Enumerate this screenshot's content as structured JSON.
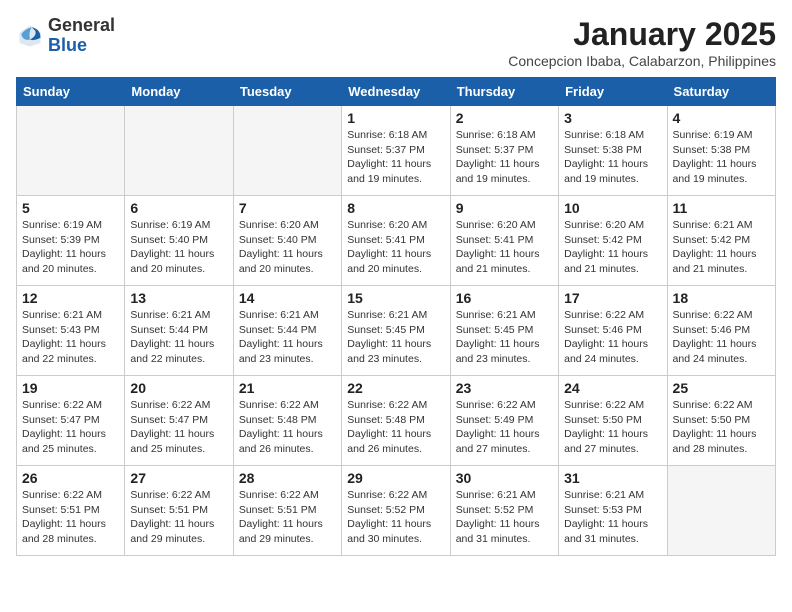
{
  "header": {
    "logo": {
      "general": "General",
      "blue": "Blue"
    },
    "title": "January 2025",
    "subtitle": "Concepcion Ibaba, Calabarzon, Philippines"
  },
  "calendar": {
    "days_of_week": [
      "Sunday",
      "Monday",
      "Tuesday",
      "Wednesday",
      "Thursday",
      "Friday",
      "Saturday"
    ],
    "weeks": [
      [
        {
          "day": "",
          "info": ""
        },
        {
          "day": "",
          "info": ""
        },
        {
          "day": "",
          "info": ""
        },
        {
          "day": "1",
          "info": "Sunrise: 6:18 AM\nSunset: 5:37 PM\nDaylight: 11 hours and 19 minutes."
        },
        {
          "day": "2",
          "info": "Sunrise: 6:18 AM\nSunset: 5:37 PM\nDaylight: 11 hours and 19 minutes."
        },
        {
          "day": "3",
          "info": "Sunrise: 6:18 AM\nSunset: 5:38 PM\nDaylight: 11 hours and 19 minutes."
        },
        {
          "day": "4",
          "info": "Sunrise: 6:19 AM\nSunset: 5:38 PM\nDaylight: 11 hours and 19 minutes."
        }
      ],
      [
        {
          "day": "5",
          "info": "Sunrise: 6:19 AM\nSunset: 5:39 PM\nDaylight: 11 hours and 20 minutes."
        },
        {
          "day": "6",
          "info": "Sunrise: 6:19 AM\nSunset: 5:40 PM\nDaylight: 11 hours and 20 minutes."
        },
        {
          "day": "7",
          "info": "Sunrise: 6:20 AM\nSunset: 5:40 PM\nDaylight: 11 hours and 20 minutes."
        },
        {
          "day": "8",
          "info": "Sunrise: 6:20 AM\nSunset: 5:41 PM\nDaylight: 11 hours and 20 minutes."
        },
        {
          "day": "9",
          "info": "Sunrise: 6:20 AM\nSunset: 5:41 PM\nDaylight: 11 hours and 21 minutes."
        },
        {
          "day": "10",
          "info": "Sunrise: 6:20 AM\nSunset: 5:42 PM\nDaylight: 11 hours and 21 minutes."
        },
        {
          "day": "11",
          "info": "Sunrise: 6:21 AM\nSunset: 5:42 PM\nDaylight: 11 hours and 21 minutes."
        }
      ],
      [
        {
          "day": "12",
          "info": "Sunrise: 6:21 AM\nSunset: 5:43 PM\nDaylight: 11 hours and 22 minutes."
        },
        {
          "day": "13",
          "info": "Sunrise: 6:21 AM\nSunset: 5:44 PM\nDaylight: 11 hours and 22 minutes."
        },
        {
          "day": "14",
          "info": "Sunrise: 6:21 AM\nSunset: 5:44 PM\nDaylight: 11 hours and 23 minutes."
        },
        {
          "day": "15",
          "info": "Sunrise: 6:21 AM\nSunset: 5:45 PM\nDaylight: 11 hours and 23 minutes."
        },
        {
          "day": "16",
          "info": "Sunrise: 6:21 AM\nSunset: 5:45 PM\nDaylight: 11 hours and 23 minutes."
        },
        {
          "day": "17",
          "info": "Sunrise: 6:22 AM\nSunset: 5:46 PM\nDaylight: 11 hours and 24 minutes."
        },
        {
          "day": "18",
          "info": "Sunrise: 6:22 AM\nSunset: 5:46 PM\nDaylight: 11 hours and 24 minutes."
        }
      ],
      [
        {
          "day": "19",
          "info": "Sunrise: 6:22 AM\nSunset: 5:47 PM\nDaylight: 11 hours and 25 minutes."
        },
        {
          "day": "20",
          "info": "Sunrise: 6:22 AM\nSunset: 5:47 PM\nDaylight: 11 hours and 25 minutes."
        },
        {
          "day": "21",
          "info": "Sunrise: 6:22 AM\nSunset: 5:48 PM\nDaylight: 11 hours and 26 minutes."
        },
        {
          "day": "22",
          "info": "Sunrise: 6:22 AM\nSunset: 5:48 PM\nDaylight: 11 hours and 26 minutes."
        },
        {
          "day": "23",
          "info": "Sunrise: 6:22 AM\nSunset: 5:49 PM\nDaylight: 11 hours and 27 minutes."
        },
        {
          "day": "24",
          "info": "Sunrise: 6:22 AM\nSunset: 5:50 PM\nDaylight: 11 hours and 27 minutes."
        },
        {
          "day": "25",
          "info": "Sunrise: 6:22 AM\nSunset: 5:50 PM\nDaylight: 11 hours and 28 minutes."
        }
      ],
      [
        {
          "day": "26",
          "info": "Sunrise: 6:22 AM\nSunset: 5:51 PM\nDaylight: 11 hours and 28 minutes."
        },
        {
          "day": "27",
          "info": "Sunrise: 6:22 AM\nSunset: 5:51 PM\nDaylight: 11 hours and 29 minutes."
        },
        {
          "day": "28",
          "info": "Sunrise: 6:22 AM\nSunset: 5:51 PM\nDaylight: 11 hours and 29 minutes."
        },
        {
          "day": "29",
          "info": "Sunrise: 6:22 AM\nSunset: 5:52 PM\nDaylight: 11 hours and 30 minutes."
        },
        {
          "day": "30",
          "info": "Sunrise: 6:21 AM\nSunset: 5:52 PM\nDaylight: 11 hours and 31 minutes."
        },
        {
          "day": "31",
          "info": "Sunrise: 6:21 AM\nSunset: 5:53 PM\nDaylight: 11 hours and 31 minutes."
        },
        {
          "day": "",
          "info": ""
        }
      ]
    ]
  }
}
